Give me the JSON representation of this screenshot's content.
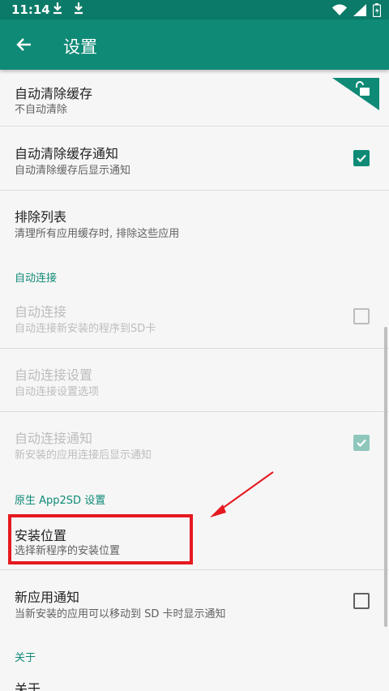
{
  "status": {
    "time": "11:14"
  },
  "toolbar": {
    "title": "设置"
  },
  "settings": {
    "auto_clear_cache": {
      "title": "自动清除缓存",
      "summary": "不自动清除"
    },
    "auto_clear_notify": {
      "title": "自动清除缓存通知",
      "summary": "自动清除缓存后显示通知",
      "checked": true
    },
    "exclude_list": {
      "title": "排除列表",
      "summary": "清理所有应用缓存时, 排除这些应用"
    },
    "category_auto_link": "自动连接",
    "auto_link": {
      "title": "自动连接",
      "summary": "自动连接新安装的程序到SD卡",
      "checked": false,
      "enabled": false
    },
    "auto_link_settings": {
      "title": "自动连接设置",
      "summary": "自动连接设置选项",
      "enabled": false
    },
    "auto_link_notify": {
      "title": "自动连接通知",
      "summary": "新安装的应用连接后显示通知",
      "checked": true,
      "enabled": false
    },
    "category_native": "原生 App2SD 设置",
    "install_location": {
      "title": "安装位置",
      "summary": "选择新程序的安装位置"
    },
    "new_app_notify": {
      "title": "新应用通知",
      "summary": "当新安装的应用可以移动到 SD 卡时显示通知",
      "checked": false
    },
    "category_about": "关于",
    "about": {
      "title": "关于"
    }
  },
  "colors": {
    "primary": "#0f8a76",
    "status_bar": "#0b7a68",
    "highlight": "#e5191f"
  }
}
